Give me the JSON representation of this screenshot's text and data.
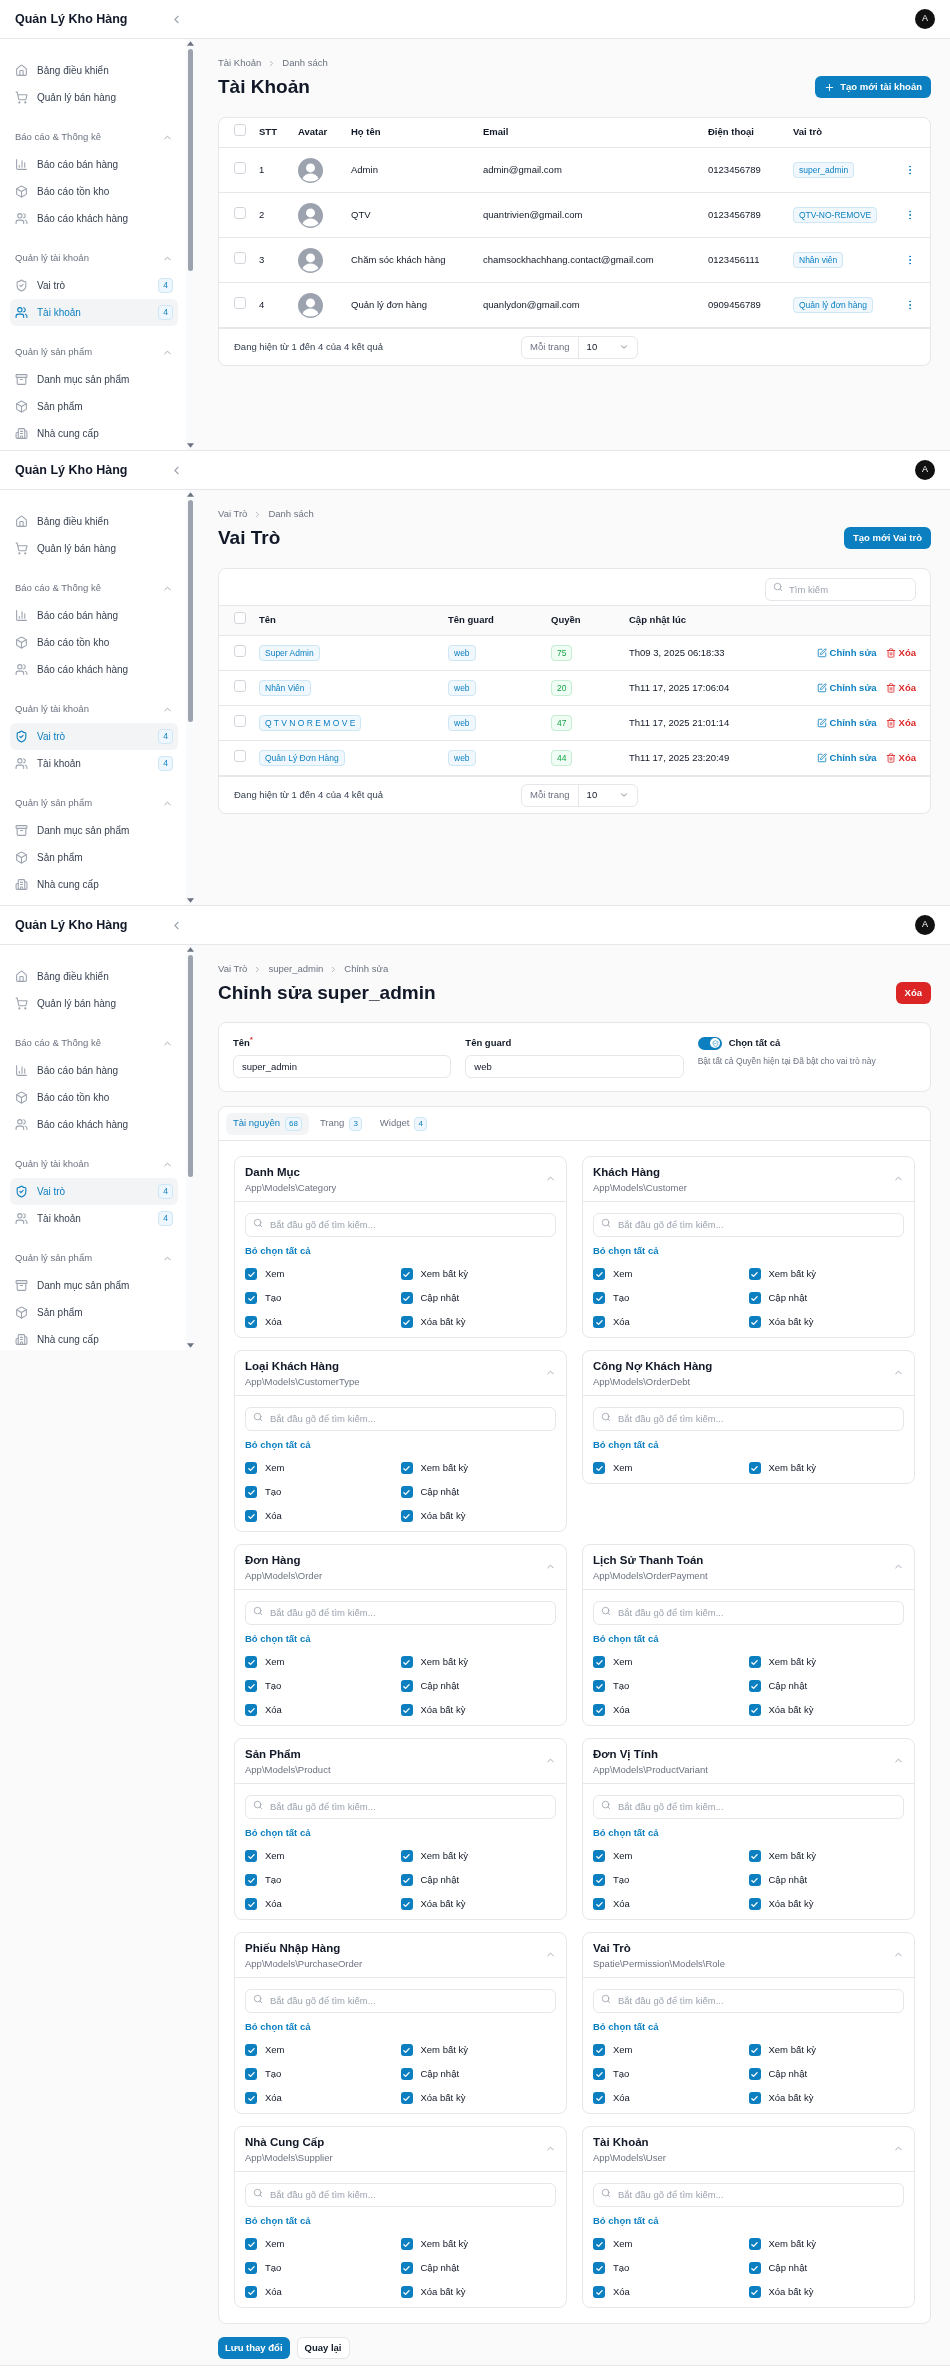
{
  "panels": [
    {
      "kind": "user_list",
      "app_title": "Quản Lý Kho Hàng",
      "avatar": "A",
      "sidebar": [
        {
          "items": [
            {
              "label": "Bảng điều khiển",
              "selected": false
            },
            {
              "label": "Quản lý bán hàng",
              "selected": false
            }
          ]
        },
        {
          "label": "Báo cáo & Thống kê",
          "expanded": true,
          "items": [
            {
              "label": "Báo cáo bán hàng",
              "selected": false
            },
            {
              "label": "Báo cáo tồn kho",
              "selected": false
            },
            {
              "label": "Báo cáo khách hàng",
              "selected": false
            }
          ]
        },
        {
          "label": "Quản lý tài khoản",
          "expanded": true,
          "items": [
            {
              "label": "Vai trò",
              "badge": "4",
              "selected": false
            },
            {
              "label": "Tài khoản",
              "badge": "4",
              "selected": true
            }
          ]
        },
        {
          "label": "Quản lý sản phẩm",
          "expanded": true,
          "items": [
            {
              "label": "Danh mục sản phẩm",
              "selected": false
            },
            {
              "label": "Sản phẩm",
              "selected": false
            },
            {
              "label": "Nhà cung cấp",
              "selected": false
            }
          ]
        }
      ],
      "breadcrumbs": [
        "Tài Khoản",
        "Danh sách"
      ],
      "title": "Tài Khoản",
      "action_button": "Tạo mới tài khoản",
      "table": {
        "all_selected": false,
        "columns": [
          "STT",
          "Avatar",
          "Họ tên",
          "Email",
          "Điện thoại",
          "Vai trò"
        ],
        "rows": [
          {
            "index": "1",
            "name": "Admin",
            "email": "admin@gmail.com",
            "phone": "0123456789",
            "role": "super_admin",
            "selected": false
          },
          {
            "index": "2",
            "name": "QTV",
            "email": "quantrivien@gmail.com",
            "phone": "0123456789",
            "role": "QTV-NO-REMOVE",
            "selected": false
          },
          {
            "index": "3",
            "name": "Chăm sóc khách hàng",
            "email": "chamsockhachhang.contact@gmail.com",
            "phone": "0123456111",
            "role": "Nhân viên",
            "selected": false
          },
          {
            "index": "4",
            "name": "Quản lý đơn hàng",
            "email": "quanlydon@gmail.com",
            "phone": "0909456789",
            "role": "Quản lý đơn hàng",
            "selected": false
          }
        ]
      },
      "footer": {
        "summary": "Đang hiện từ 1 đến 4 của 4 kết quả",
        "per_page_label": "Mỗi trang",
        "per_page": "10"
      }
    },
    {
      "kind": "role_list",
      "app_title": "Quản Lý Kho Hàng",
      "avatar": "A",
      "sidebar": [
        {
          "items": [
            {
              "label": "Bảng điều khiển",
              "selected": false
            },
            {
              "label": "Quản lý bán hàng",
              "selected": false
            }
          ]
        },
        {
          "label": "Báo cáo & Thống kê",
          "expanded": true,
          "items": [
            {
              "label": "Báo cáo bán hàng",
              "selected": false
            },
            {
              "label": "Báo cáo tồn kho",
              "selected": false
            },
            {
              "label": "Báo cáo khách hàng",
              "selected": false
            }
          ]
        },
        {
          "label": "Quản lý tài khoản",
          "expanded": true,
          "items": [
            {
              "label": "Vai trò",
              "badge": "4",
              "selected": true
            },
            {
              "label": "Tài khoản",
              "badge": "4",
              "selected": false
            }
          ]
        },
        {
          "label": "Quản lý sản phẩm",
          "expanded": true,
          "items": [
            {
              "label": "Danh mục sản phẩm",
              "selected": false
            },
            {
              "label": "Sản phẩm",
              "selected": false
            },
            {
              "label": "Nhà cung cấp",
              "selected": false
            }
          ]
        }
      ],
      "breadcrumbs": [
        "Vai Trò",
        "Danh sách"
      ],
      "title": "Vai Trò",
      "action_button": "Tạo mới Vai trò",
      "search": {
        "placeholder": "Tìm kiếm"
      },
      "table": {
        "all_selected": false,
        "columns": [
          "Tên",
          "Tên guard",
          "Quyền",
          "Cập nhật lúc"
        ],
        "rows": [
          {
            "name": "Super Admin",
            "guard": "web",
            "permissions": "75",
            "updated_at": "Th09 3, 2025 06:18:33",
            "actions": [
              "Chỉnh sửa",
              "Xóa"
            ],
            "selected": false
          },
          {
            "name": "Nhân Viên",
            "guard": "web",
            "permissions": "20",
            "updated_at": "Th11 17, 2025 17:06:04",
            "actions": [
              "Chỉnh sửa",
              "Xóa"
            ],
            "selected": false
          },
          {
            "name": "Q T V N O R E M O V E",
            "guard": "web",
            "permissions": "47",
            "updated_at": "Th11 17, 2025 21:01:14",
            "actions": [
              "Chỉnh sửa",
              "Xóa"
            ],
            "selected": false
          },
          {
            "name": "Quản Lý Đơn Hàng",
            "guard": "web",
            "permissions": "44",
            "updated_at": "Th11 17, 2025 23:20:49",
            "actions": [
              "Chỉnh sửa",
              "Xóa"
            ],
            "selected": false
          }
        ]
      },
      "footer": {
        "summary": "Đang hiện từ 1 đến 4 của 4 kết quả",
        "per_page_label": "Mỗi trang",
        "per_page": "10"
      }
    },
    {
      "kind": "role_edit",
      "app_title": "Quản Lý Kho Hàng",
      "avatar": "A",
      "sidebar": [
        {
          "items": [
            {
              "label": "Bảng điều khiển",
              "selected": false
            },
            {
              "label": "Quản lý bán hàng",
              "selected": false
            }
          ]
        },
        {
          "label": "Báo cáo & Thống kê",
          "expanded": true,
          "items": [
            {
              "label": "Báo cáo bán hàng",
              "selected": false
            },
            {
              "label": "Báo cáo tồn kho",
              "selected": false
            },
            {
              "label": "Báo cáo khách hàng",
              "selected": false
            }
          ]
        },
        {
          "label": "Quản lý tài khoản",
          "expanded": true,
          "items": [
            {
              "label": "Vai trò",
              "badge": "4",
              "selected": true
            },
            {
              "label": "Tài khoản",
              "badge": "4",
              "selected": false
            }
          ]
        },
        {
          "label": "Quản lý sản phẩm",
          "expanded": true,
          "items": [
            {
              "label": "Danh mục sản phẩm",
              "selected": false
            },
            {
              "label": "Sản phẩm",
              "selected": false
            },
            {
              "label": "Nhà cung cấp",
              "selected": false
            }
          ]
        }
      ],
      "breadcrumbs": [
        "Vai Trò",
        "super_admin",
        "Chỉnh sửa"
      ],
      "title": "Chỉnh sửa super_admin",
      "action_button": "Xóa",
      "form": {
        "fields": [
          {
            "label": "Tên",
            "required_mark": "*",
            "value": "super_admin"
          },
          {
            "label": "Tên guard",
            "value": "web"
          }
        ],
        "select_all": {
          "label": "Chọn tất cả",
          "on": true,
          "hint": "Bật tất cả Quyền hiện tại Đã bật cho vai trò này"
        }
      },
      "tabs": [
        {
          "label": "Tài nguyên",
          "count": "68",
          "selected": true
        },
        {
          "label": "Trang",
          "count": "3",
          "selected": false
        },
        {
          "label": "Widget",
          "count": "4",
          "selected": false
        }
      ],
      "resources": [
        {
          "title": "Danh Mục",
          "model": "App\\Models\\Category",
          "placeholder": "Bắt đầu gõ để tìm kiếm...",
          "deselect": "Bỏ chọn tất cả",
          "expanded": true,
          "permissions": [
            {
              "label": "Xem",
              "checked": true
            },
            {
              "label": "Xem bất kỳ",
              "checked": true
            },
            {
              "label": "Tạo",
              "checked": true
            },
            {
              "label": "Cập nhật",
              "checked": true
            },
            {
              "label": "Xóa",
              "checked": true
            },
            {
              "label": "Xóa bất kỳ",
              "checked": true
            }
          ]
        },
        {
          "title": "Khách Hàng",
          "model": "App\\Models\\Customer",
          "placeholder": "Bắt đầu gõ để tìm kiếm...",
          "deselect": "Bỏ chọn tất cả",
          "expanded": true,
          "permissions": [
            {
              "label": "Xem",
              "checked": true
            },
            {
              "label": "Xem bất kỳ",
              "checked": true
            },
            {
              "label": "Tạo",
              "checked": true
            },
            {
              "label": "Cập nhật",
              "checked": true
            },
            {
              "label": "Xóa",
              "checked": true
            },
            {
              "label": "Xóa bất kỳ",
              "checked": true
            }
          ]
        },
        {
          "title": "Loại Khách Hàng",
          "model": "App\\Models\\CustomerType",
          "placeholder": "Bắt đầu gõ để tìm kiếm...",
          "deselect": "Bỏ chọn tất cả",
          "expanded": true,
          "permissions": [
            {
              "label": "Xem",
              "checked": true
            },
            {
              "label": "Xem bất kỳ",
              "checked": true
            },
            {
              "label": "Tạo",
              "checked": true
            },
            {
              "label": "Cập nhật",
              "checked": true
            },
            {
              "label": "Xóa",
              "checked": true
            },
            {
              "label": "Xóa bất kỳ",
              "checked": true
            }
          ]
        },
        {
          "title": "Công Nợ Khách Hàng",
          "model": "App\\Models\\OrderDebt",
          "placeholder": "Bắt đầu gõ để tìm kiếm...",
          "deselect": "Bỏ chọn tất cả",
          "expanded": true,
          "permissions": [
            {
              "label": "Xem",
              "checked": true
            },
            {
              "label": "Xem bất kỳ",
              "checked": true
            }
          ]
        },
        {
          "title": "Đơn Hàng",
          "model": "App\\Models\\Order",
          "placeholder": "Bắt đầu gõ để tìm kiếm...",
          "deselect": "Bỏ chọn tất cả",
          "expanded": true,
          "permissions": [
            {
              "label": "Xem",
              "checked": true
            },
            {
              "label": "Xem bất kỳ",
              "checked": true
            },
            {
              "label": "Tạo",
              "checked": true
            },
            {
              "label": "Cập nhật",
              "checked": true
            },
            {
              "label": "Xóa",
              "checked": true
            },
            {
              "label": "Xóa bất kỳ",
              "checked": true
            }
          ]
        },
        {
          "title": "Lịch Sử Thanh Toán",
          "model": "App\\Models\\OrderPayment",
          "placeholder": "Bắt đầu gõ để tìm kiếm...",
          "deselect": "Bỏ chọn tất cả",
          "expanded": true,
          "permissions": [
            {
              "label": "Xem",
              "checked": true
            },
            {
              "label": "Xem bất kỳ",
              "checked": true
            },
            {
              "label": "Tạo",
              "checked": true
            },
            {
              "label": "Cập nhật",
              "checked": true
            },
            {
              "label": "Xóa",
              "checked": true
            },
            {
              "label": "Xóa bất kỳ",
              "checked": true
            }
          ]
        },
        {
          "title": "Sản Phẩm",
          "model": "App\\Models\\Product",
          "placeholder": "Bắt đầu gõ để tìm kiếm...",
          "deselect": "Bỏ chọn tất cả",
          "expanded": true,
          "permissions": [
            {
              "label": "Xem",
              "checked": true
            },
            {
              "label": "Xem bất kỳ",
              "checked": true
            },
            {
              "label": "Tạo",
              "checked": true
            },
            {
              "label": "Cập nhật",
              "checked": true
            },
            {
              "label": "Xóa",
              "checked": true
            },
            {
              "label": "Xóa bất kỳ",
              "checked": true
            }
          ]
        },
        {
          "title": "Đơn Vị Tính",
          "model": "App\\Models\\ProductVariant",
          "placeholder": "Bắt đầu gõ để tìm kiếm...",
          "deselect": "Bỏ chọn tất cả",
          "expanded": true,
          "permissions": [
            {
              "label": "Xem",
              "checked": true
            },
            {
              "label": "Xem bất kỳ",
              "checked": true
            },
            {
              "label": "Tạo",
              "checked": true
            },
            {
              "label": "Cập nhật",
              "checked": true
            },
            {
              "label": "Xóa",
              "checked": true
            },
            {
              "label": "Xóa bất kỳ",
              "checked": true
            }
          ]
        },
        {
          "title": "Phiếu Nhập Hàng",
          "model": "App\\Models\\PurchaseOrder",
          "placeholder": "Bắt đầu gõ để tìm kiếm...",
          "deselect": "Bỏ chọn tất cả",
          "expanded": true,
          "permissions": [
            {
              "label": "Xem",
              "checked": true
            },
            {
              "label": "Xem bất kỳ",
              "checked": true
            },
            {
              "label": "Tạo",
              "checked": true
            },
            {
              "label": "Cập nhật",
              "checked": true
            },
            {
              "label": "Xóa",
              "checked": true
            },
            {
              "label": "Xóa bất kỳ",
              "checked": true
            }
          ]
        },
        {
          "title": "Vai Trò",
          "model": "Spatie\\Permission\\Models\\Role",
          "placeholder": "Bắt đầu gõ để tìm kiếm...",
          "deselect": "Bỏ chọn tất cả",
          "expanded": true,
          "permissions": [
            {
              "label": "Xem",
              "checked": true
            },
            {
              "label": "Xem bất kỳ",
              "checked": true
            },
            {
              "label": "Tạo",
              "checked": true
            },
            {
              "label": "Cập nhật",
              "checked": true
            },
            {
              "label": "Xóa",
              "checked": true
            },
            {
              "label": "Xóa bất kỳ",
              "checked": true
            }
          ]
        },
        {
          "title": "Nhà Cung Cấp",
          "model": "App\\Models\\Supplier",
          "placeholder": "Bắt đầu gõ để tìm kiếm...",
          "deselect": "Bỏ chọn tất cả",
          "expanded": true,
          "permissions": [
            {
              "label": "Xem",
              "checked": true
            },
            {
              "label": "Xem bất kỳ",
              "checked": true
            },
            {
              "label": "Tạo",
              "checked": true
            },
            {
              "label": "Cập nhật",
              "checked": true
            },
            {
              "label": "Xóa",
              "checked": true
            },
            {
              "label": "Xóa bất kỳ",
              "checked": true
            }
          ]
        },
        {
          "title": "Tài Khoản",
          "model": "App\\Models\\User",
          "placeholder": "Bắt đầu gõ để tìm kiếm...",
          "deselect": "Bỏ chọn tất cả",
          "expanded": true,
          "permissions": [
            {
              "label": "Xem",
              "checked": true
            },
            {
              "label": "Xem bất kỳ",
              "checked": true
            },
            {
              "label": "Tạo",
              "checked": true
            },
            {
              "label": "Cập nhật",
              "checked": true
            },
            {
              "label": "Xóa",
              "checked": true
            },
            {
              "label": "Xóa bất kỳ",
              "checked": true
            }
          ]
        }
      ],
      "footer_buttons": [
        "Lưu thay đổi",
        "Quay lại"
      ]
    }
  ]
}
